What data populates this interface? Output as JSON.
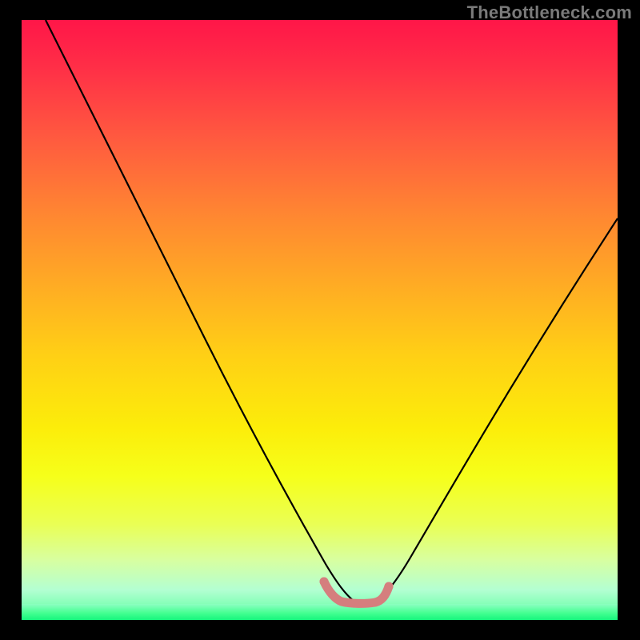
{
  "watermark": "TheBottleneck.com",
  "chart_data": {
    "type": "line",
    "title": "",
    "xlabel": "",
    "ylabel": "",
    "xlim": [
      0,
      100
    ],
    "ylim": [
      0,
      100
    ],
    "series": [
      {
        "name": "black-curve",
        "color": "#000000",
        "x": [
          4,
          10,
          20,
          30,
          40,
          45,
          50,
          53,
          58,
          60,
          65,
          70,
          80,
          90,
          100
        ],
        "values": [
          100,
          90,
          73,
          56,
          37,
          27,
          16,
          7,
          3,
          3,
          8,
          16,
          32,
          50,
          67
        ]
      },
      {
        "name": "pink-valley",
        "color": "#d98080",
        "x": [
          50.5,
          51.5,
          52.5,
          53.5,
          55,
          57,
          58.5,
          60,
          61
        ],
        "values": [
          6.5,
          4.5,
          3.2,
          3.0,
          2.8,
          2.8,
          2.9,
          3.2,
          6.0
        ]
      }
    ],
    "background": {
      "type": "vertical-gradient",
      "stops": [
        {
          "pos": 0,
          "color": "#ff1648"
        },
        {
          "pos": 20,
          "color": "#ff5b3f"
        },
        {
          "pos": 44,
          "color": "#ffab24"
        },
        {
          "pos": 68,
          "color": "#fced0a"
        },
        {
          "pos": 90,
          "color": "#d8ffa0"
        },
        {
          "pos": 100,
          "color": "#16f57d"
        }
      ]
    }
  }
}
